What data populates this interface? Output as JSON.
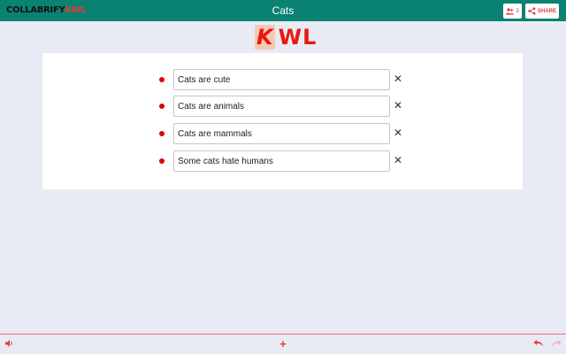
{
  "header": {
    "brand_part1": "COLLABRIFY",
    "brand_part2": "KWL",
    "title": "Cats",
    "users_count": "3",
    "share_label": "SHARE"
  },
  "logo": {
    "k": "K",
    "w": "W",
    "l": "L"
  },
  "items": [
    {
      "text": "Cats are cute"
    },
    {
      "text": "Cats are animals"
    },
    {
      "text": "Cats are mammals"
    },
    {
      "text": "Some cats hate humans"
    }
  ],
  "icons": {
    "users": "users-icon",
    "share": "share-icon",
    "delete": "close-icon",
    "speaker": "speaker-icon",
    "add": "plus-icon",
    "undo": "undo-icon",
    "redo": "redo-icon"
  },
  "colors": {
    "topbar": "#0a8272",
    "accent": "#e53935",
    "background": "#e8eaf4",
    "bullet": "#e0000b"
  },
  "bottombar": {
    "add_symbol": "+"
  }
}
